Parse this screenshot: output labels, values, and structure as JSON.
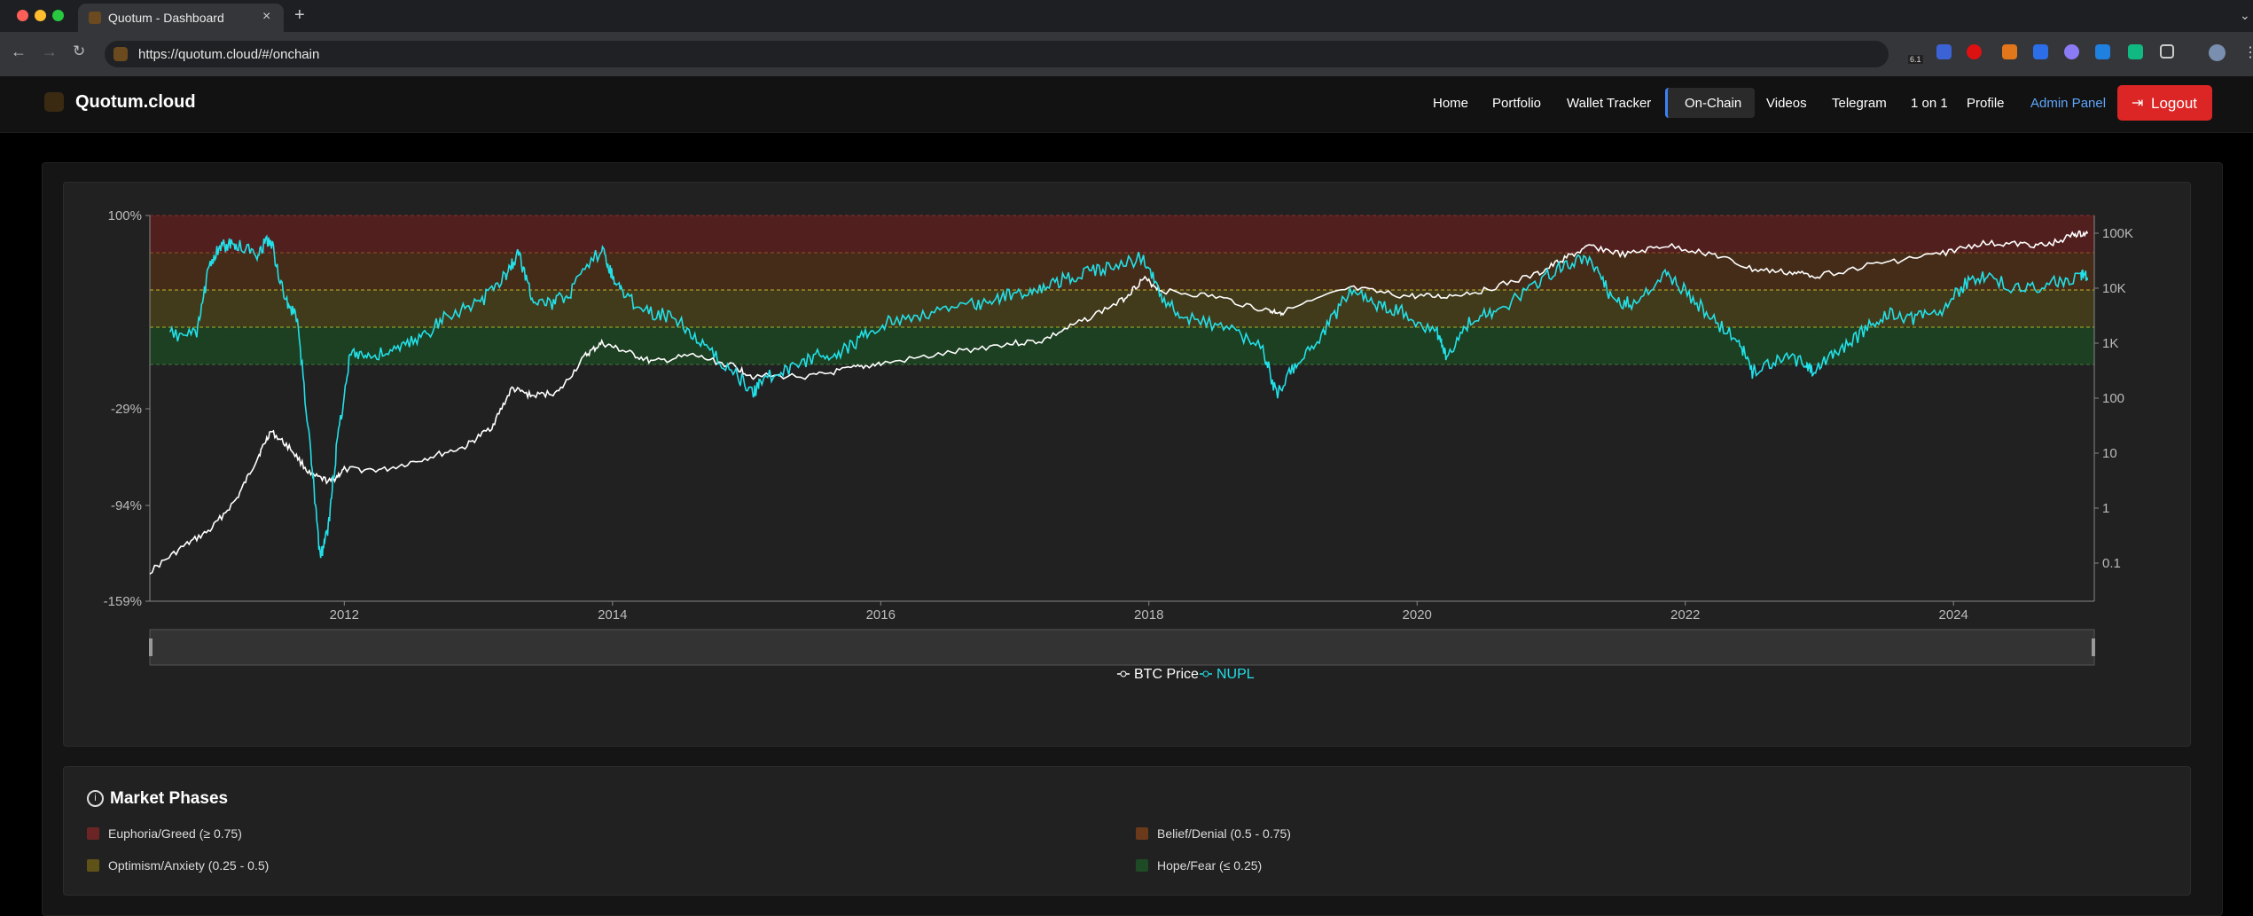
{
  "browser": {
    "tab_title": "Quotum - Dashboard",
    "tab_close": "×",
    "new_tab": "+",
    "url": "https://quotum.cloud/#/onchain",
    "ext_badge": "6.1"
  },
  "site": {
    "brand": "Quotum.cloud",
    "nav": [
      "Home",
      "Portfolio",
      "Wallet Tracker",
      "On-Chain",
      "Videos",
      "Telegram",
      "1 on 1",
      "Profile",
      "Admin Panel"
    ],
    "logout": "Logout"
  },
  "colors": {
    "nupl": "#22e0e8",
    "btc": "#ffffff",
    "admin_link": "#60a5fa",
    "logout_bg": "#dc2626"
  },
  "chart_data": {
    "type": "line",
    "x_ticks": [
      "2012",
      "2014",
      "2016",
      "2018",
      "2020",
      "2022",
      "2024"
    ],
    "left_ticks": [
      "100%",
      "-29%",
      "-94%",
      "-159%"
    ],
    "right_ticks": [
      "100K",
      "10K",
      "1K",
      "100",
      "10",
      "1",
      "0.1"
    ],
    "right_scale": "log",
    "bands": [
      {
        "name": "Euphoria/Greed",
        "from": 0.75,
        "to": 1.0,
        "color": "#5a1e1e"
      },
      {
        "name": "Belief/Denial",
        "from": 0.5,
        "to": 0.75,
        "color": "#4a2e16"
      },
      {
        "name": "Optimism/Anxiety",
        "from": 0.25,
        "to": 0.5,
        "color": "#46401a"
      },
      {
        "name": "Hope/Fear",
        "from": 0.0,
        "to": 0.25,
        "color": "#1c4422"
      }
    ],
    "series": [
      {
        "name": "BTC Price",
        "axis": "right",
        "x": [
          2010.55,
          2010.8,
          2011.0,
          2011.2,
          2011.35,
          2011.45,
          2011.6,
          2011.75,
          2011.9,
          2012.0,
          2012.3,
          2012.6,
          2012.9,
          2013.1,
          2013.25,
          2013.4,
          2013.6,
          2013.8,
          2013.92,
          2014.1,
          2014.3,
          2014.6,
          2014.9,
          2015.05,
          2015.5,
          2015.8,
          2016.0,
          2016.5,
          2016.9,
          2017.2,
          2017.5,
          2017.8,
          2017.96,
          2018.1,
          2018.5,
          2018.9,
          2019.0,
          2019.5,
          2019.9,
          2020.2,
          2020.5,
          2020.9,
          2021.1,
          2021.3,
          2021.55,
          2021.85,
          2022.2,
          2022.5,
          2022.8,
          2023.0,
          2023.5,
          2023.9,
          2024.2,
          2024.5,
          2024.7,
          2024.9,
          2025.0
        ],
        "y": [
          0.07,
          0.2,
          0.4,
          1.5,
          8,
          25,
          12,
          4,
          3,
          5,
          5,
          8,
          13,
          30,
          150,
          110,
          130,
          600,
          1000,
          700,
          450,
          600,
          380,
          250,
          250,
          350,
          420,
          650,
          950,
          1100,
          2500,
          6000,
          15000,
          9000,
          7000,
          3800,
          3700,
          10000,
          7200,
          7000,
          9200,
          18000,
          35000,
          58000,
          40000,
          60000,
          42000,
          22000,
          19000,
          17000,
          30000,
          42000,
          65000,
          63000,
          60000,
          95000,
          98000
        ]
      },
      {
        "name": "NUPL",
        "axis": "left",
        "x": [
          2010.7,
          2010.9,
          2011.0,
          2011.1,
          2011.2,
          2011.35,
          2011.45,
          2011.55,
          2011.65,
          2011.75,
          2011.82,
          2011.88,
          2011.95,
          2012.05,
          2012.2,
          2012.4,
          2012.6,
          2012.8,
          2013.0,
          2013.2,
          2013.3,
          2013.4,
          2013.55,
          2013.7,
          2013.92,
          2014.0,
          2014.1,
          2014.3,
          2014.5,
          2014.7,
          2014.9,
          2015.05,
          2015.1,
          2015.3,
          2015.5,
          2015.7,
          2015.9,
          2016.1,
          2016.4,
          2016.7,
          2016.9,
          2017.1,
          2017.3,
          2017.5,
          2017.7,
          2017.96,
          2018.1,
          2018.3,
          2018.6,
          2018.85,
          2018.95,
          2019.1,
          2019.3,
          2019.5,
          2019.7,
          2019.9,
          2020.15,
          2020.22,
          2020.4,
          2020.6,
          2020.9,
          2021.1,
          2021.3,
          2021.45,
          2021.6,
          2021.85,
          2022.0,
          2022.2,
          2022.4,
          2022.5,
          2022.7,
          2022.9,
          2022.95,
          2023.1,
          2023.3,
          2023.5,
          2023.7,
          2023.9,
          2024.1,
          2024.25,
          2024.5,
          2024.75,
          2024.95,
          2025.0
        ],
        "y": [
          0.2,
          0.2,
          0.7,
          0.8,
          0.8,
          0.75,
          0.85,
          0.45,
          0.3,
          -0.6,
          -1.3,
          -1.1,
          -0.5,
          0.1,
          0.05,
          0.1,
          0.2,
          0.35,
          0.4,
          0.6,
          0.75,
          0.45,
          0.4,
          0.5,
          0.78,
          0.6,
          0.45,
          0.35,
          0.3,
          0.1,
          -0.05,
          -0.2,
          -0.1,
          -0.05,
          0.05,
          0.08,
          0.2,
          0.3,
          0.35,
          0.4,
          0.45,
          0.5,
          0.55,
          0.6,
          0.65,
          0.72,
          0.45,
          0.3,
          0.25,
          0.1,
          -0.2,
          0.0,
          0.2,
          0.5,
          0.4,
          0.35,
          0.2,
          0.05,
          0.3,
          0.35,
          0.55,
          0.68,
          0.7,
          0.45,
          0.4,
          0.6,
          0.5,
          0.3,
          0.15,
          -0.05,
          0.05,
          0.0,
          -0.05,
          0.05,
          0.2,
          0.35,
          0.3,
          0.35,
          0.55,
          0.6,
          0.5,
          0.55,
          0.6,
          0.58
        ]
      }
    ],
    "legend": [
      "BTC Price",
      "NUPL"
    ],
    "legend_placement": "bottom-center",
    "grid": false
  },
  "phases": {
    "title": "Market Phases",
    "items": [
      {
        "label": "Euphoria/Greed (≥ 0.75)",
        "color": "#6b2525"
      },
      {
        "label": "Belief/Denial (0.5 - 0.75)",
        "color": "#6b3a1a"
      },
      {
        "label": "Optimism/Anxiety (0.25 - 0.5)",
        "color": "#5e5218"
      },
      {
        "label": "Hope/Fear (≤ 0.25)",
        "color": "#1f4a26"
      }
    ]
  }
}
